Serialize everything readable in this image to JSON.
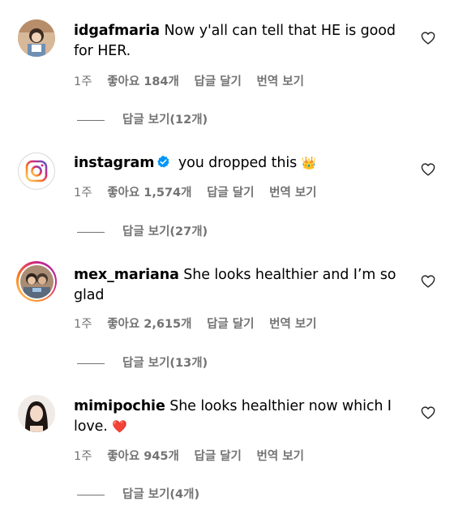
{
  "comments": [
    {
      "username": "idgafmaria",
      "text": "Now y'all can tell that HE is good for HER.",
      "time": "1주",
      "likes": "좋아요 184개",
      "reply": "답글 달기",
      "translate": "번역 보기",
      "view_replies": "답글 보기(12개)",
      "avatar_icon": "user-photo"
    },
    {
      "username": "instagram",
      "verified": true,
      "text": "you dropped this",
      "emoji": "👑",
      "time": "1주",
      "likes": "좋아요 1,574개",
      "reply": "답글 달기",
      "translate": "번역 보기",
      "view_replies": "답글 보기(27개)",
      "avatar_icon": "instagram-logo"
    },
    {
      "username": "mex_mariana",
      "text": "She looks healthier and I’m so glad",
      "time": "1주",
      "likes": "좋아요 2,615개",
      "reply": "답글 달기",
      "translate": "번역 보기",
      "view_replies": "답글 보기(13개)",
      "avatar_icon": "user-photo-story-ring"
    },
    {
      "username": "mimipochie",
      "text": "She looks healthier now which I love.",
      "emoji": "❤️",
      "time": "1주",
      "likes": "좋아요 945개",
      "reply": "답글 달기",
      "translate": "번역 보기",
      "view_replies": "답글 보기(4개)",
      "avatar_icon": "user-photo"
    }
  ],
  "colors": {
    "meta_gray": "#737373",
    "verified_blue": "#0095f6",
    "story_ring_start": "#feda75",
    "story_ring_end": "#d62976"
  },
  "icons": {
    "like": "heart-outline-icon",
    "verified": "verified-badge-icon"
  }
}
